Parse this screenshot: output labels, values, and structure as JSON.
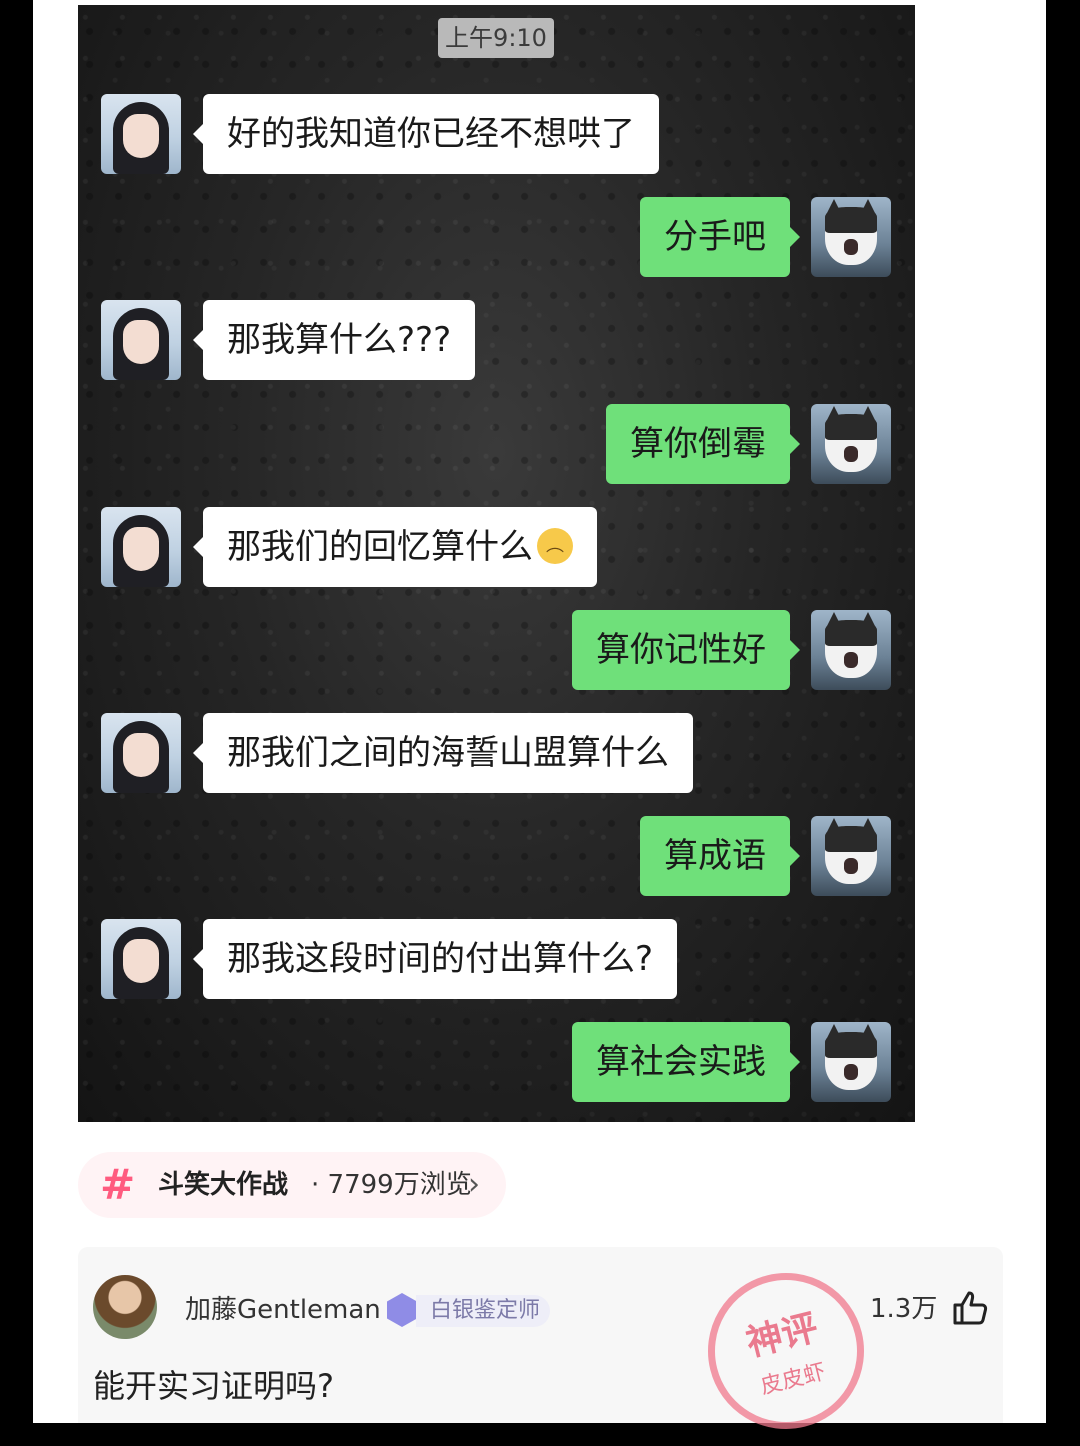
{
  "chat": {
    "time": "上午9:10",
    "messages": [
      {
        "side": "in",
        "text": "好的我知道你已经不想哄了"
      },
      {
        "side": "out",
        "text": "分手吧"
      },
      {
        "side": "in",
        "text": "那我算什么???"
      },
      {
        "side": "out",
        "text": "算你倒霉"
      },
      {
        "side": "in",
        "text": "那我们的回忆算什么",
        "emoji": "frowning-face-icon"
      },
      {
        "side": "out",
        "text": "算你记性好"
      },
      {
        "side": "in",
        "text": "那我们之间的海誓山盟算什么"
      },
      {
        "side": "out",
        "text": "算成语"
      },
      {
        "side": "in",
        "text": "那我这段时间的付出算什么?"
      },
      {
        "side": "out",
        "text": "算社会实践"
      }
    ],
    "colors": {
      "outgoing_bubble": "#6fe07a",
      "incoming_bubble": "#ffffff"
    }
  },
  "topic": {
    "name": "斗笑大作战",
    "views": "· 7799万浏览",
    "icon": "hashtag-icon",
    "chevron": "›",
    "accent": "#ff5b7f"
  },
  "comment": {
    "username": "加藤Gentleman",
    "badge": "白银鉴定师",
    "likes": "1.3万",
    "like_icon": "thumbs-up-icon",
    "text": "能开实习证明吗?",
    "stamp_line1": "神评",
    "stamp_line2": "皮皮虾"
  }
}
